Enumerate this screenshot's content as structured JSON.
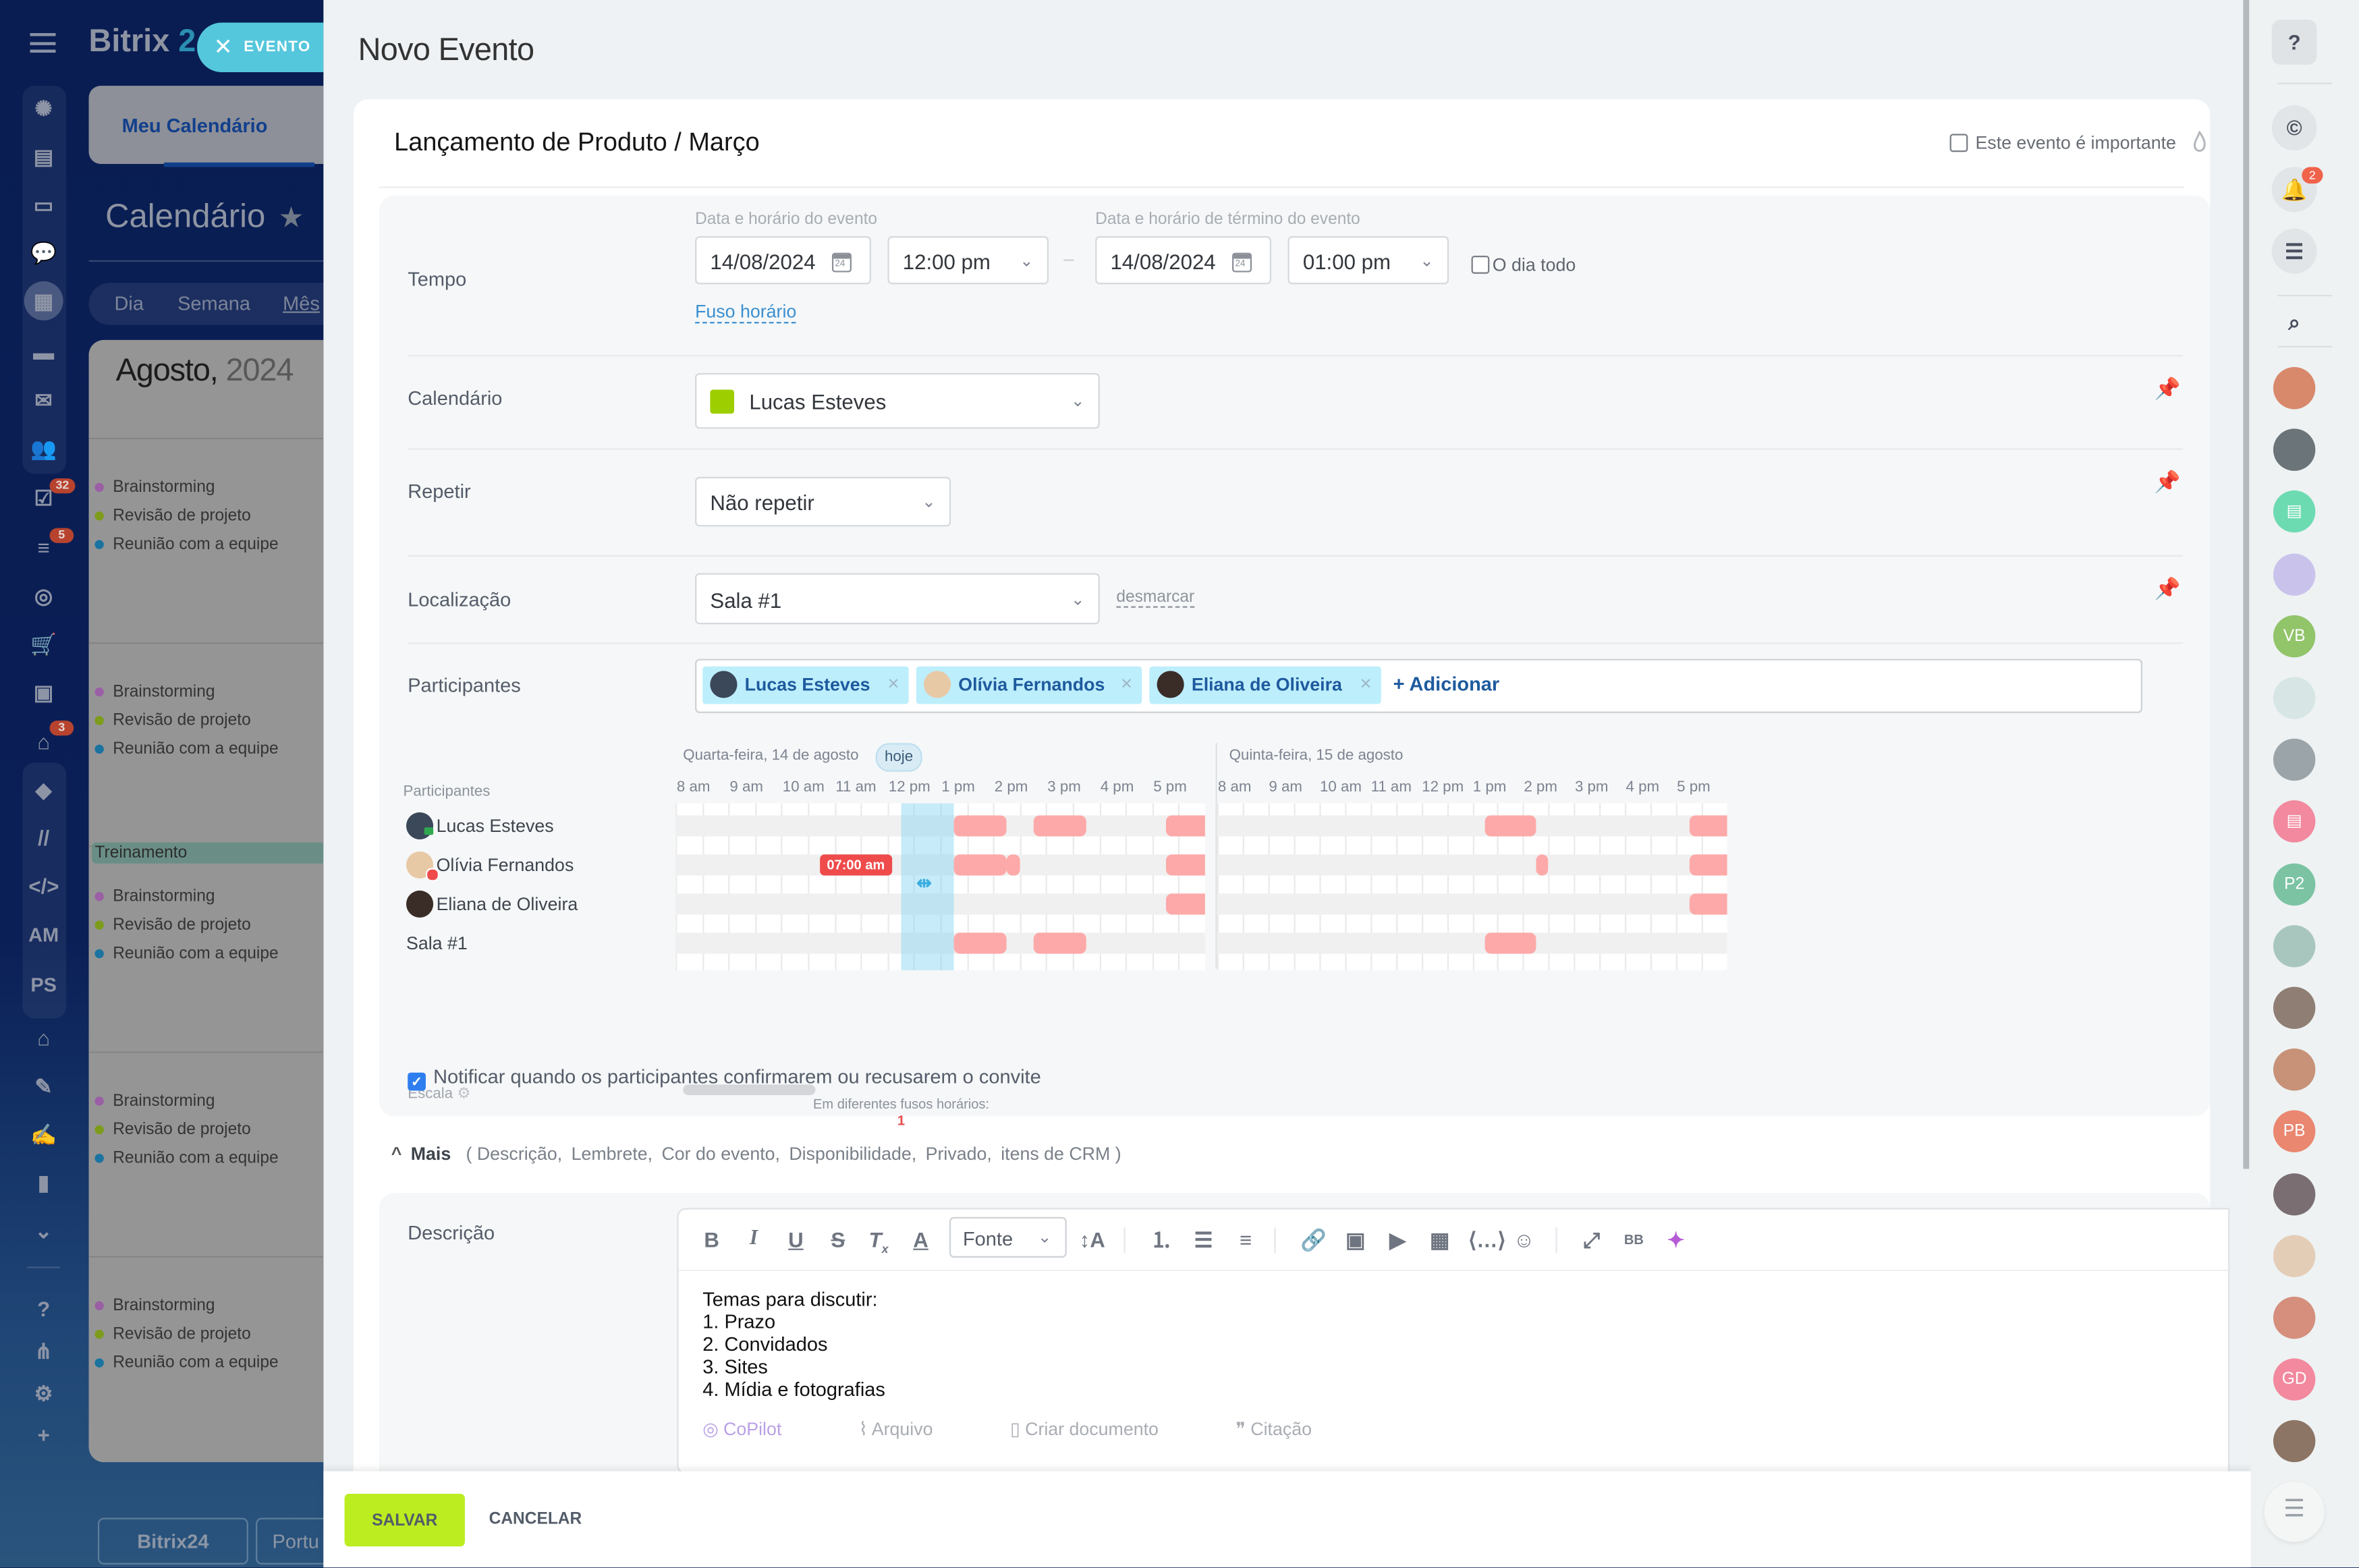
{
  "background_app": {
    "logo": "Bitrix",
    "logo_suffix": "2",
    "close_button_label": "EVENTO",
    "nav_tab": "Meu Calendário",
    "page_title": "Calendário",
    "views": [
      "Dia",
      "Semana",
      "Mês"
    ],
    "active_view": "Mês",
    "month_label": "Agosto,",
    "year_label": "2024",
    "nav_badges": {
      "tasks": "32",
      "crm": "5",
      "robots": "3"
    },
    "nav_text_items": [
      "AM",
      "PS"
    ],
    "weeks": [
      {
        "events": [
          "Brainstorming",
          "Revisão de projeto",
          "Reunião com a equipe"
        ]
      },
      {
        "events": [
          "Brainstorming",
          "Revisão de projeto",
          "Reunião com a equipe"
        ]
      },
      {
        "banner": "Treinamento",
        "events": [
          "Brainstorming",
          "Revisão de projeto",
          "Reunião com a equipe"
        ]
      },
      {
        "events": [
          "Brainstorming",
          "Revisão de projeto",
          "Reunião com a equipe"
        ]
      },
      {
        "events": [
          "Brainstorming",
          "Revisão de projeto",
          "Reunião com a equipe"
        ]
      }
    ],
    "event_colors": {
      "Brainstorming": "#9b5fa5",
      "Revisão de projeto": "#7d9c1b",
      "Reunião com a equipe": "#1a73a0"
    },
    "footer_logo": "Bitrix24",
    "footer_lang": "Portu"
  },
  "slider": {
    "title": "Novo Evento",
    "event_name": "Lançamento de Produto / Março",
    "important_label": "Este evento é importante",
    "important_checked": false,
    "time": {
      "label": "Tempo",
      "start_label": "Data e horário do evento",
      "end_label": "Data e horário de término do evento",
      "start_date": "14/08/2024",
      "start_time": "12:00 pm",
      "end_date": "14/08/2024",
      "end_time": "01:00 pm",
      "separator": "–",
      "all_day_label": "O dia todo",
      "all_day_checked": false,
      "timezone_link": "Fuso horário",
      "calendar_icon_day": "24"
    },
    "calendar": {
      "label": "Calendário",
      "value": "Lucas Esteves",
      "color": "#9dcf00"
    },
    "repeat": {
      "label": "Repetir",
      "value": "Não repetir"
    },
    "location": {
      "label": "Localização",
      "value": "Sala #1",
      "clear_link": "desmarcar"
    },
    "participants": {
      "label": "Participantes",
      "tags": [
        "Lucas Esteves",
        "Olívia Fernandos",
        "Eliana de Oliveira"
      ],
      "add_label": "+ Adicionar"
    },
    "planner": {
      "participants_header": "Participantes",
      "days": [
        {
          "label": "Quarta-feira, 14 de agosto",
          "today_chip": "hoje"
        },
        {
          "label": "Quinta-feira, 15 de agosto"
        }
      ],
      "hours": [
        "8 am",
        "9 am",
        "10 am",
        "11 am",
        "12 pm",
        "1 pm",
        "2 pm",
        "3 pm",
        "4 pm",
        "5 pm"
      ],
      "rows": [
        {
          "name": "Lucas Esteves",
          "status": "host",
          "busy": [
            [
              [
                13,
                14
              ],
              [
                14.5,
                15.5
              ],
              [
                17,
                18
              ]
            ],
            [
              [
                13,
                14
              ],
              [
                17,
                18
              ]
            ]
          ]
        },
        {
          "name": "Olívia Fernandos",
          "status": "warning",
          "busy": [
            [
              [
                13,
                14
              ],
              [
                14,
                14.25
              ],
              [
                17,
                18
              ]
            ],
            [
              [
                14,
                14.25
              ],
              [
                17,
                18
              ]
            ]
          ]
        },
        {
          "name": "Eliana de Oliveira",
          "status": "",
          "busy": [
            [
              [
                17,
                18
              ]
            ],
            [
              [
                17,
                18
              ]
            ]
          ]
        },
        {
          "name": "Sala #1",
          "status": "",
          "busy": [
            [
              [
                13,
                14
              ],
              [
                14.5,
                15.5
              ]
            ],
            [
              [
                13,
                14
              ]
            ]
          ]
        }
      ],
      "selection": {
        "day": 0,
        "start": 12,
        "end": 13
      },
      "timezone_warning_time": "07:00 am",
      "scale_label": "Escala",
      "timezone_note": "Em diferentes fusos horários:",
      "timezone_count": "1",
      "busy_color": "#fea9a9"
    },
    "notify": {
      "label": "Notificar quando os participantes confirmarem ou recusarem o convite",
      "checked": true
    },
    "more": {
      "label": "Mais",
      "options": [
        "( Descrição,",
        "Lembrete,",
        "Cor do evento,",
        "Disponibilidade,",
        "Privado,",
        "itens de CRM )"
      ]
    },
    "description": {
      "label": "Descrição",
      "font_select": "Fonte",
      "body_lines": [
        "Temas para discutir:",
        "1. Prazo",
        "2. Convidados",
        "3. Sites",
        "4. Mídia e fotografias"
      ],
      "actions": [
        "CoPilot",
        "Arquivo",
        "Criar documento",
        "Citação"
      ]
    },
    "footer": {
      "save": "SALVAR",
      "cancel": "CANCELAR"
    },
    "accent_color": "#bbed21"
  },
  "right_panel": {
    "notification_count": "2",
    "avatars": [
      {
        "type": "photo",
        "color": "#d8896b"
      },
      {
        "type": "photo",
        "color": "#6a7479"
      },
      {
        "type": "icon",
        "color": "#6ddbb1"
      },
      {
        "type": "photo",
        "color": "#c9c3ec"
      },
      {
        "type": "initials",
        "text": "VB",
        "color": "#92c46a"
      },
      {
        "type": "photo",
        "color": "#d7e5e5"
      },
      {
        "type": "photo",
        "color": "#9aa4a9"
      },
      {
        "type": "icon",
        "color": "#f2899e"
      },
      {
        "type": "initials",
        "text": "P2",
        "color": "#7bc3a3"
      },
      {
        "type": "photo",
        "color": "#a8c6be"
      },
      {
        "type": "photo",
        "color": "#8f7e74"
      },
      {
        "type": "photo",
        "color": "#c79278"
      },
      {
        "type": "initials",
        "text": "PB",
        "color": "#ea8770"
      },
      {
        "type": "photo",
        "color": "#7a6e72"
      },
      {
        "type": "photo",
        "color": "#e4cdb7"
      },
      {
        "type": "photo",
        "color": "#d58f7c"
      },
      {
        "type": "initials",
        "text": "GD",
        "color": "#f2899e"
      },
      {
        "type": "photo",
        "color": "#8d7565"
      }
    ]
  }
}
